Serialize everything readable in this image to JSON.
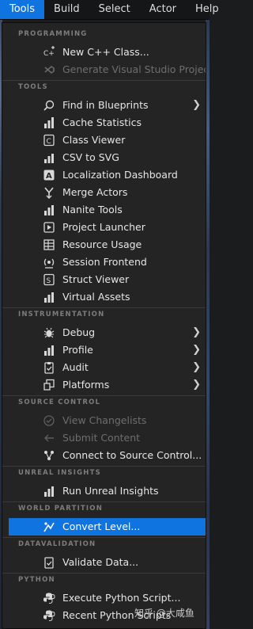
{
  "menubar": {
    "items": [
      "Tools",
      "Build",
      "Select",
      "Actor",
      "Help"
    ],
    "active_index": 0
  },
  "sections": {
    "programming": "PROGRAMMING",
    "tools": "TOOLS",
    "instrumentation": "INSTRUMENTATION",
    "source_control": "SOURCE CONTROL",
    "unreal_insights": "UNREAL INSIGHTS",
    "world_partition": "WORLD PARTITION",
    "datavalidation": "DATAVALIDATION",
    "python": "PYTHON"
  },
  "items": {
    "new_cpp_class": "New C++ Class...",
    "generate_vs": "Generate Visual Studio Project",
    "find_in_blueprints": "Find in Blueprints",
    "cache_statistics": "Cache Statistics",
    "class_viewer": "Class Viewer",
    "csv_to_svg": "CSV to SVG",
    "localization_dashboard": "Localization Dashboard",
    "merge_actors": "Merge Actors",
    "nanite_tools": "Nanite Tools",
    "project_launcher": "Project Launcher",
    "resource_usage": "Resource Usage",
    "session_frontend": "Session Frontend",
    "struct_viewer": "Struct Viewer",
    "virtual_assets": "Virtual Assets",
    "debug": "Debug",
    "profile": "Profile",
    "audit": "Audit",
    "platforms": "Platforms",
    "view_changelists": "View Changelists",
    "submit_content": "Submit Content",
    "connect_source_control": "Connect to Source Control...",
    "run_unreal_insights": "Run Unreal Insights",
    "convert_level": "Convert Level...",
    "validate_data": "Validate Data...",
    "execute_python_script": "Execute Python Script...",
    "recent_python_scripts": "Recent Python Scripts"
  },
  "watermark": "知乎 @大咸鱼",
  "colors": {
    "accent": "#0f74e0",
    "menu_bg": "#242424",
    "section_text": "#7c7c7c",
    "disabled_text": "#6e6e6e"
  }
}
